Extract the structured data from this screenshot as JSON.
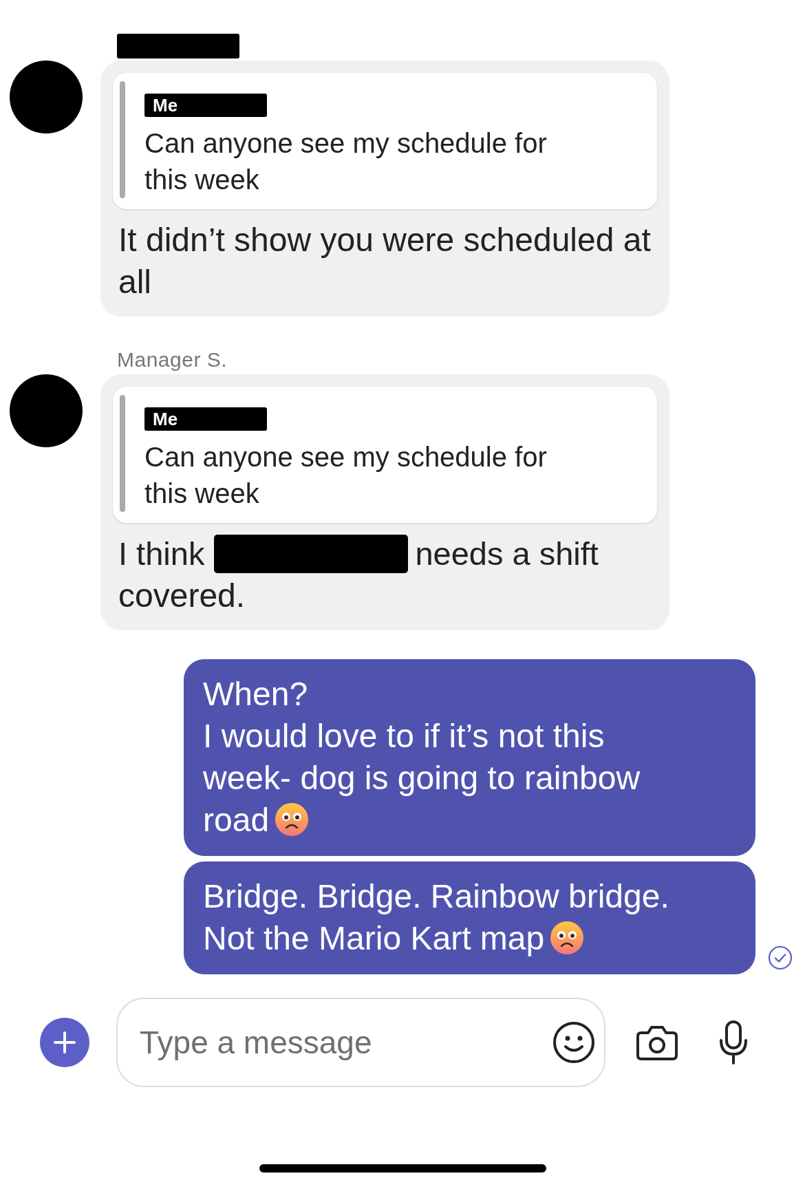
{
  "conversation": [
    {
      "kind": "received",
      "quote": {
        "author": "Me",
        "text": "Can anyone see my schedule for this week"
      },
      "text": "It didn’t show you were scheduled at all"
    },
    {
      "kind": "received",
      "sender_name": "Manager S.",
      "quote": {
        "author": "Me",
        "text": "Can anyone see my schedule for this week"
      },
      "text_before": "I think",
      "text_after": "needs a shift",
      "text_end": "covered."
    },
    {
      "kind": "sent",
      "paragraphs": [
        "When?",
        "I would love to if it’s not this week- dog is going to rainbow road"
      ],
      "emoji": true,
      "read": false
    },
    {
      "kind": "sent",
      "paragraphs": [
        "Bridge. Bridge. Rainbow bridge.",
        "Not the Mario Kart map"
      ],
      "emoji": true,
      "read": true
    }
  ],
  "composer": {
    "placeholder": "Type a message"
  }
}
